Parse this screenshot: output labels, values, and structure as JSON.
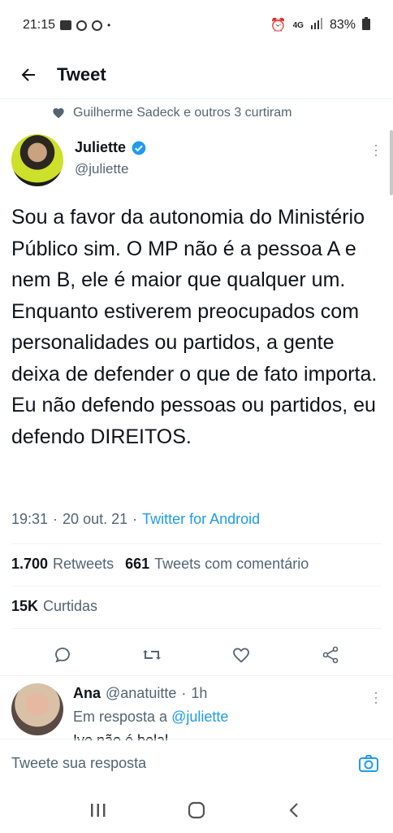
{
  "status_bar": {
    "time": "21:15",
    "network": "4G",
    "battery": "83%"
  },
  "header": {
    "title": "Tweet",
    "back_icon": "arrow-left-icon"
  },
  "social_context": {
    "text": "Guilherme Sadeck e outros 3 curtiram",
    "icon": "heart-icon"
  },
  "tweet": {
    "author_name": "Juliette",
    "author_handle": "@juliette",
    "verified": true,
    "text": "Sou a favor da autonomia do Ministério Público sim. O MP não é a pessoa A e nem B, ele é maior que qualquer um. Enquanto estiverem preocupados com personalidades ou partidos, a gente deixa de defender o que de fato importa. Eu não defendo pessoas ou partidos, eu defendo DIREITOS.",
    "time": "19:31",
    "date": "20 out. 21",
    "source": "Twitter for Android",
    "separator": "·"
  },
  "stats": {
    "retweets_count": "1.700",
    "retweets_label": "Retweets",
    "quotes_count": "661",
    "quotes_label": "Tweets com comentário",
    "likes_count": "15K",
    "likes_label": "Curtidas"
  },
  "actions": [
    {
      "name": "reply-icon"
    },
    {
      "name": "retweet-icon"
    },
    {
      "name": "like-icon"
    },
    {
      "name": "share-icon"
    }
  ],
  "reply": {
    "name": "Ana",
    "handle": "@anatuitte",
    "separator": "·",
    "time": "1h",
    "context_prefix": "Em resposta a",
    "context_mention": "@juliette",
    "text_partial": "Ivo não é bolal..."
  },
  "compose": {
    "placeholder": "Tweete sua resposta",
    "camera_icon": "camera-icon"
  },
  "nav": {
    "recents_icon": "recents-icon",
    "home_icon": "home-icon",
    "back_icon": "nav-back-icon"
  },
  "colors": {
    "accent": "#1d9bf0",
    "text_primary": "#0f1419",
    "text_secondary": "#536471",
    "divider": "#eff3f4"
  }
}
